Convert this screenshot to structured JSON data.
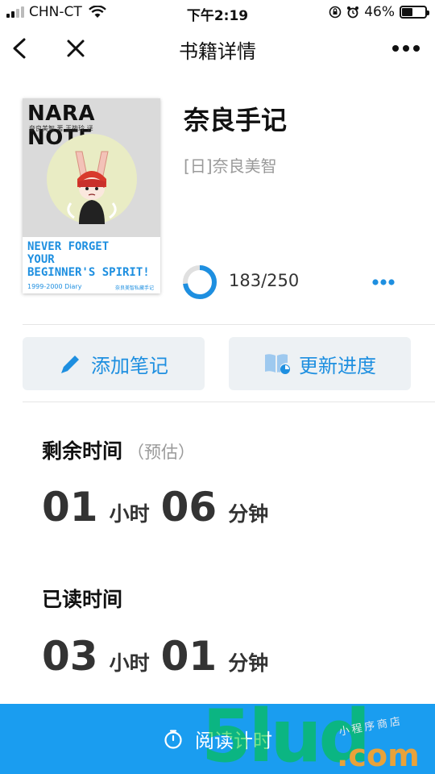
{
  "status_bar": {
    "carrier": "CHN-CT",
    "time": "下午2:19",
    "battery": "46%",
    "battery_level": 0.46
  },
  "nav": {
    "title": "书籍详情",
    "back_icon": "chevron-left-icon",
    "close_icon": "close-icon",
    "more_icon": "more-horizontal-icon"
  },
  "book": {
    "title": "奈良手记",
    "author": "[日]奈良美智",
    "cover": {
      "title": "NARA NOTE",
      "author_line": "奈良美智 著    王筱玲 译",
      "tagline": "NEVER FORGET\nYOUR\nBEGINNER'S SPIRIT!",
      "diary": "1999-2000 Diary",
      "publisher": "奈良美智私藏手记"
    },
    "progress": {
      "text": "183/250",
      "current": 183,
      "total": 250
    }
  },
  "actions": {
    "add_note": "添加笔记",
    "update_progress": "更新进度"
  },
  "remaining": {
    "label": "剩余时间",
    "hint": "（预估）",
    "hours": "01",
    "hours_unit": "小时",
    "minutes": "06",
    "minutes_unit": "分钟"
  },
  "read": {
    "label": "已读时间",
    "hours": "03",
    "hours_unit": "小时",
    "minutes": "01",
    "minutes_unit": "分钟"
  },
  "bottom": {
    "label": "阅读计时",
    "icon": "timer-icon"
  },
  "watermark": {
    "big": "5lud",
    "small": "小程序商店",
    "com": ".com"
  },
  "colors": {
    "accent": "#1e8fe0",
    "bottom_bar": "#1a9df0",
    "button_bg": "#edf1f4"
  }
}
